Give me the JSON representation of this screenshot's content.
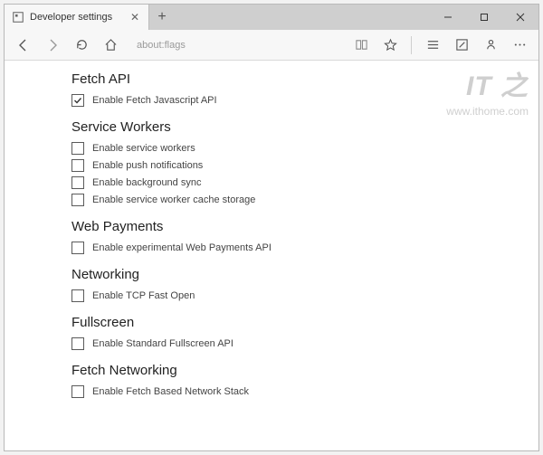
{
  "window": {
    "minimize": "—",
    "maximize": "☐",
    "close": "✕"
  },
  "tab": {
    "title": "Developer settings",
    "close": "✕",
    "newtab": "+"
  },
  "toolbar": {
    "address": "about:flags"
  },
  "watermark": {
    "logo": "IT 之",
    "url": "www.ithome.com"
  },
  "sections": [
    {
      "title": "Fetch API",
      "options": [
        {
          "label": "Enable Fetch Javascript API",
          "checked": true
        }
      ]
    },
    {
      "title": "Service Workers",
      "options": [
        {
          "label": "Enable service workers",
          "checked": false
        },
        {
          "label": "Enable push notifications",
          "checked": false
        },
        {
          "label": "Enable background sync",
          "checked": false
        },
        {
          "label": "Enable service worker cache storage",
          "checked": false
        }
      ]
    },
    {
      "title": "Web Payments",
      "options": [
        {
          "label": "Enable experimental Web Payments API",
          "checked": false
        }
      ]
    },
    {
      "title": "Networking",
      "options": [
        {
          "label": "Enable TCP Fast Open",
          "checked": false
        }
      ]
    },
    {
      "title": "Fullscreen",
      "options": [
        {
          "label": "Enable Standard Fullscreen API",
          "checked": false
        }
      ]
    },
    {
      "title": "Fetch Networking",
      "options": [
        {
          "label": "Enable Fetch Based Network Stack",
          "checked": false
        }
      ]
    }
  ]
}
